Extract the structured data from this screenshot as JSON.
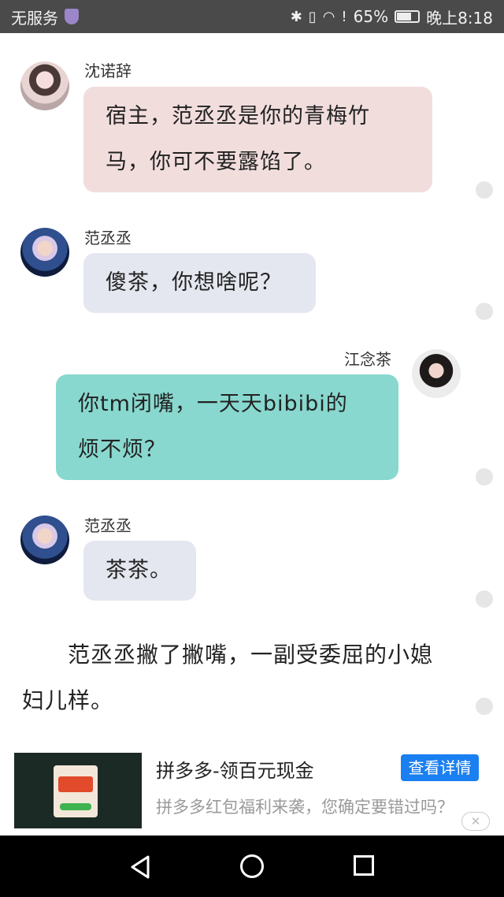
{
  "status_bar": {
    "carrier": "无服务",
    "battery": "65%",
    "battery_level": 0.65,
    "time": "晚上8:18"
  },
  "messages": [
    {
      "sender": "沈诺辞",
      "side": "left",
      "avatar": "girl-avatar-pink",
      "text_lines": [
        "宿主，范丞丞是你的青梅竹",
        "马，你可不要露馅了。"
      ]
    },
    {
      "sender": "范丞丞",
      "side": "left",
      "avatar": "boy-avatar-blonde",
      "text_lines": [
        "傻茶，你想啥呢？"
      ]
    },
    {
      "sender": "江念茶",
      "side": "right",
      "avatar": "girl-avatar-dark-hair",
      "text_lines": [
        "你tm闭嘴，一天天bibibi的",
        "烦不烦？"
      ]
    },
    {
      "sender": "范丞丞",
      "side": "left",
      "avatar": "boy-avatar-blonde",
      "text_lines": [
        "茶茶。"
      ]
    }
  ],
  "narration": {
    "lines": [
      "　　范丞丞撇了撇嘴，一副受委屈的小媳",
      "妇儿样。"
    ]
  },
  "ad": {
    "title": "拼多多-领百元现金",
    "button": "查看详情",
    "description": "拼多多红包福利来袭，您确定要错过吗？",
    "close": "✕"
  },
  "navigation": {
    "back": "back-icon",
    "home": "home-icon",
    "recent": "recent-apps-icon"
  }
}
